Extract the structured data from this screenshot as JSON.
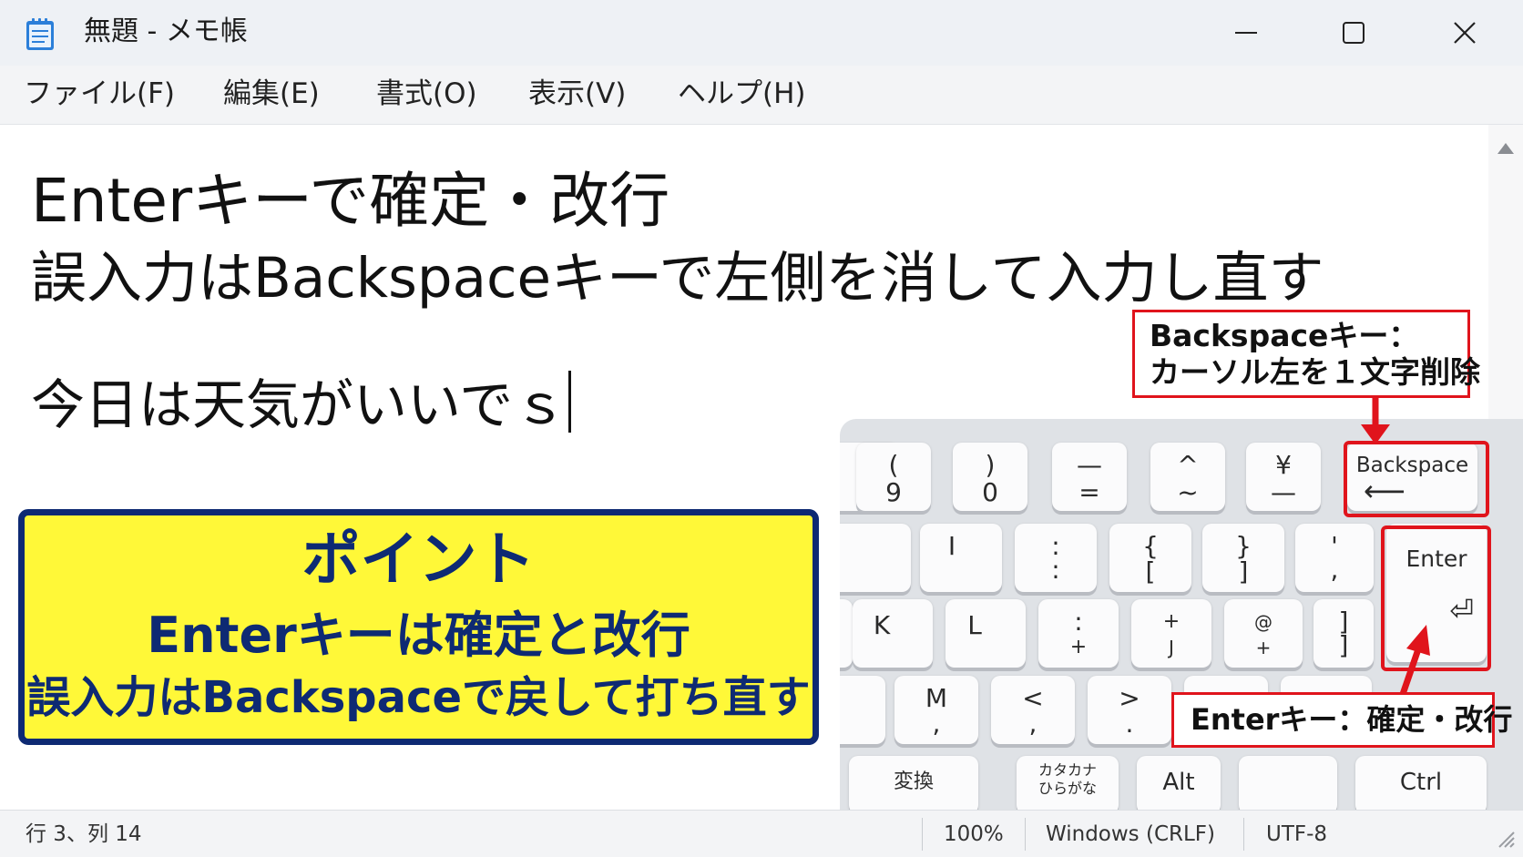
{
  "window": {
    "title": "無題 - メモ帳"
  },
  "icons": {
    "app": "notepad-icon",
    "minimize": "minimize-icon",
    "maximize": "maximize-icon",
    "close": "close-icon",
    "scroll_up": "scroll-up-arrow-icon",
    "resize": "resize-grip-icon"
  },
  "menu": [
    "ファイル(F)",
    "編集(E)",
    "書式(O)",
    "表示(V)",
    "ヘルプ(H)"
  ],
  "editor": {
    "lines": [
      "Enterキーで確定・改行",
      "誤入力はBackspaceキーで左側を消して入力し直す",
      "今日は天気がいいでｓ"
    ]
  },
  "point": {
    "title": "ポイント",
    "line1": "Enterキーは確定と改行",
    "line2": "誤入力はBackspaceで戻して打ち直す"
  },
  "callouts": {
    "backspace_line1": "Backspaceキー：",
    "backspace_line2": "カーソル左を１文字削除",
    "enter": "Enterキー：確定・改行"
  },
  "keyboard": {
    "row1": [
      {
        "top": "(",
        "bottom": "9"
      },
      {
        "top": ")",
        "bottom": "0"
      },
      {
        "top": "—",
        "bottom": "="
      },
      {
        "top": "^",
        "bottom": "~"
      },
      {
        "top": "¥",
        "bottom": "—"
      }
    ],
    "backspace": {
      "label": "Backspace",
      "arrow": "⟵"
    },
    "row2": [
      {
        "top": "I",
        "bottom": ""
      },
      {
        "top": ":",
        "bottom": ":"
      },
      {
        "top": "{",
        "bottom": "["
      },
      {
        "top": "}",
        "bottom": "]"
      },
      {
        "top": "'",
        "bottom": ","
      }
    ],
    "enter": {
      "label": "Enter",
      "arrow": "⏎"
    },
    "row3": [
      {
        "top": "K",
        "bottom": ""
      },
      {
        "top": "L",
        "bottom": ""
      },
      {
        "top": ":",
        "bottom": "+"
      },
      {
        "top": "+",
        "bottom": "J"
      },
      {
        "top": "@",
        "bottom": "+"
      },
      {
        "top": "]",
        "bottom": "]"
      }
    ],
    "row4": [
      {
        "top": "M",
        "bottom": ","
      },
      {
        "top": "<",
        "bottom": ","
      },
      {
        "top": ">",
        "bottom": "."
      }
    ],
    "row5": {
      "henkan": "変換",
      "kana_top": "カタカナ",
      "kana_bottom": "ひらがな",
      "alt": "Alt",
      "ctrl": "Ctrl"
    }
  },
  "status": {
    "position": "行 3、列 14",
    "zoom": "100%",
    "line_ending": "Windows (CRLF)",
    "encoding": "UTF-8"
  }
}
